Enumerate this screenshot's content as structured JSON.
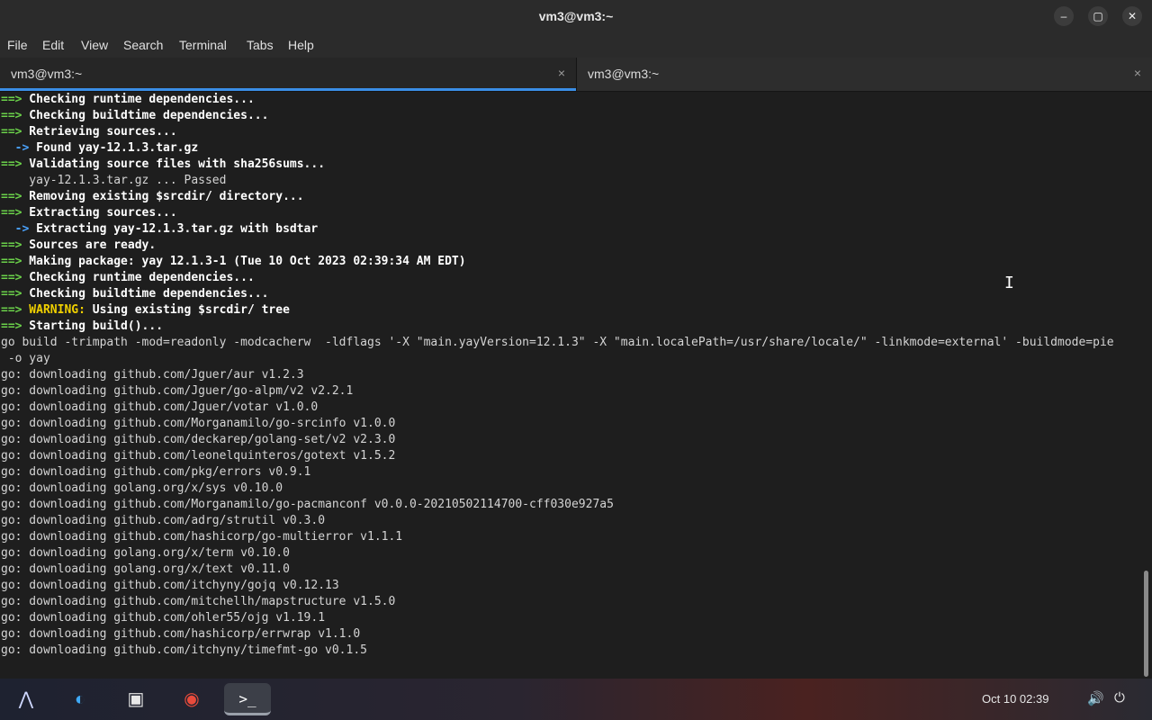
{
  "window": {
    "title": "vm3@vm3:~",
    "minimize_glyph": "–",
    "maximize_glyph": "▢",
    "close_glyph": "✕"
  },
  "menu": [
    "File",
    "Edit",
    "View",
    "Search",
    "Terminal",
    "Tabs",
    "Help"
  ],
  "tabs": [
    {
      "label": "vm3@vm3:~",
      "close": "×",
      "active": true
    },
    {
      "label": "vm3@vm3:~",
      "close": "×",
      "active": false
    }
  ],
  "terminal": {
    "lines": [
      {
        "kind": "arrow",
        "prefix": "==>",
        "text": " Checking runtime dependencies..."
      },
      {
        "kind": "arrow",
        "prefix": "==>",
        "text": " Checking buildtime dependencies..."
      },
      {
        "kind": "arrow",
        "prefix": "==>",
        "text": " Retrieving sources..."
      },
      {
        "kind": "sub",
        "prefix": "  ->",
        "text": " Found yay-12.1.3.tar.gz"
      },
      {
        "kind": "arrow",
        "prefix": "==>",
        "text": " Validating source files with sha256sums..."
      },
      {
        "kind": "plain",
        "text": "    yay-12.1.3.tar.gz ... Passed"
      },
      {
        "kind": "arrow",
        "prefix": "==>",
        "text": " Removing existing $srcdir/ directory..."
      },
      {
        "kind": "arrow",
        "prefix": "==>",
        "text": " Extracting sources..."
      },
      {
        "kind": "sub",
        "prefix": "  ->",
        "text": " Extracting yay-12.1.3.tar.gz with bsdtar"
      },
      {
        "kind": "arrow",
        "prefix": "==>",
        "text": " Sources are ready."
      },
      {
        "kind": "arrow",
        "prefix": "==>",
        "text": " Making package: yay 12.1.3-1 (Tue 10 Oct 2023 02:39:34 AM EDT)"
      },
      {
        "kind": "arrow",
        "prefix": "==>",
        "text": " Checking runtime dependencies..."
      },
      {
        "kind": "arrow",
        "prefix": "==>",
        "text": " Checking buildtime dependencies..."
      },
      {
        "kind": "warning",
        "prefix": "==>",
        "warn": " WARNING:",
        "text": " Using existing $srcdir/ tree"
      },
      {
        "kind": "arrow",
        "prefix": "==>",
        "text": " Starting build()..."
      },
      {
        "kind": "plain",
        "text": "go build -trimpath -mod=readonly -modcacherw  -ldflags '-X \"main.yayVersion=12.1.3\" -X \"main.localePath=/usr/share/locale/\" -linkmode=external' -buildmode=pie"
      },
      {
        "kind": "plain",
        "text": " -o yay"
      },
      {
        "kind": "plain",
        "text": "go: downloading github.com/Jguer/aur v1.2.3"
      },
      {
        "kind": "plain",
        "text": "go: downloading github.com/Jguer/go-alpm/v2 v2.2.1"
      },
      {
        "kind": "plain",
        "text": "go: downloading github.com/Jguer/votar v1.0.0"
      },
      {
        "kind": "plain",
        "text": "go: downloading github.com/Morganamilo/go-srcinfo v1.0.0"
      },
      {
        "kind": "plain",
        "text": "go: downloading github.com/deckarep/golang-set/v2 v2.3.0"
      },
      {
        "kind": "plain",
        "text": "go: downloading github.com/leonelquinteros/gotext v1.5.2"
      },
      {
        "kind": "plain",
        "text": "go: downloading github.com/pkg/errors v0.9.1"
      },
      {
        "kind": "plain",
        "text": "go: downloading golang.org/x/sys v0.10.0"
      },
      {
        "kind": "plain",
        "text": "go: downloading github.com/Morganamilo/go-pacmanconf v0.0.0-20210502114700-cff030e927a5"
      },
      {
        "kind": "plain",
        "text": "go: downloading github.com/adrg/strutil v0.3.0"
      },
      {
        "kind": "plain",
        "text": "go: downloading github.com/hashicorp/go-multierror v1.1.1"
      },
      {
        "kind": "plain",
        "text": "go: downloading golang.org/x/term v0.10.0"
      },
      {
        "kind": "plain",
        "text": "go: downloading golang.org/x/text v0.11.0"
      },
      {
        "kind": "plain",
        "text": "go: downloading github.com/itchyny/gojq v0.12.13"
      },
      {
        "kind": "plain",
        "text": "go: downloading github.com/mitchellh/mapstructure v1.5.0"
      },
      {
        "kind": "plain",
        "text": "go: downloading github.com/ohler55/ojg v1.19.1"
      },
      {
        "kind": "plain",
        "text": "go: downloading github.com/hashicorp/errwrap v1.1.0"
      },
      {
        "kind": "plain",
        "text": "go: downloading github.com/itchyny/timefmt-go v0.1.5"
      }
    ]
  },
  "taskbar": {
    "apps": [
      {
        "name": "launcher-icon",
        "glyph": "⋀"
      },
      {
        "name": "browser-globe-icon",
        "glyph": "◐"
      },
      {
        "name": "app-store-icon",
        "glyph": "▣"
      },
      {
        "name": "chrome-icon",
        "glyph": "◉"
      },
      {
        "name": "terminal-icon",
        "glyph": ">_",
        "active": true
      }
    ],
    "clock": "Oct 10  02:39",
    "volume_glyph": "🔊",
    "power_glyph": "⏻"
  },
  "colors": {
    "arrow_green": "#6bd14a",
    "sub_arrow_blue": "#4aa3ff",
    "warning_yellow": "#f0d000",
    "tab_accent": "#3a8ee6"
  }
}
